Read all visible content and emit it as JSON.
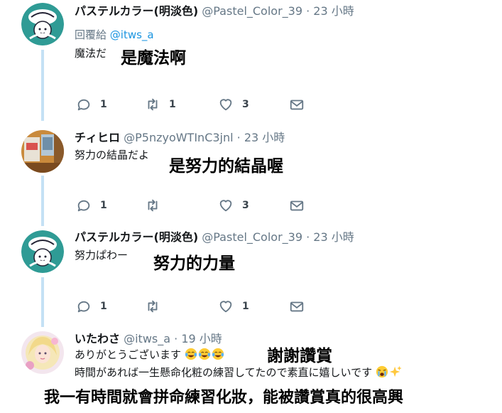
{
  "tweets": [
    {
      "display_name": "パステルカラー(明淡色)",
      "handle": "@Pastel_Color_39",
      "separator": "·",
      "time": "23 小時",
      "reply_prefix": "回覆給",
      "reply_mention": "@itws_a",
      "text": "魔法だ",
      "translation": "是魔法啊",
      "reply_count": "1",
      "retweet_count": "1",
      "like_count": "3",
      "avatar_icon": "pastel-avatar"
    },
    {
      "display_name": "チィヒロ",
      "handle": "@P5nzyoWTInC3jnl",
      "separator": "·",
      "time": "23 小時",
      "text": "努力の結晶だよ",
      "translation": "是努力的結晶喔",
      "reply_count": "1",
      "retweet_count": "",
      "like_count": "3",
      "avatar_icon": "chihiro-avatar"
    },
    {
      "display_name": "パステルカラー(明淡色)",
      "handle": "@Pastel_Color_39",
      "separator": "·",
      "time": "23 小時",
      "text": "努力ぱわー",
      "translation": "努力的力量",
      "reply_count": "1",
      "retweet_count": "",
      "like_count": "1",
      "avatar_icon": "pastel-avatar"
    },
    {
      "display_name": "いたわさ",
      "handle": "@itws_a",
      "separator": "·",
      "time": "19 小時",
      "text_line1": "ありがとうございます",
      "text_line2": "時間があれば一生懸命化粧の練習してたので素直に嬉しいです",
      "translation1": "謝謝讚賞",
      "translation2": "我一有時間就會拼命練習化妝，能被讚賞真的很高興",
      "avatar_icon": "itwsa-avatar"
    }
  ],
  "icons": {
    "reply": "reply-bubble-icon",
    "retweet": "retweet-icon",
    "like": "heart-icon",
    "dm": "envelope-icon",
    "emoji_laugh": "tears-of-joy-emoji",
    "emoji_cry": "loudly-crying-emoji",
    "emoji_sparkle": "sparkles-emoji"
  },
  "colors": {
    "link": "#1b95e0",
    "muted": "#657786",
    "thread_line": "#c4e1f5",
    "icon": "#657786"
  }
}
